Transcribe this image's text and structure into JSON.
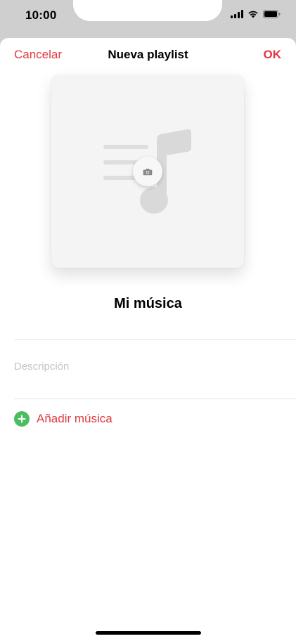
{
  "status_bar": {
    "time": "10:00"
  },
  "nav": {
    "cancel_label": "Cancelar",
    "title": "Nueva playlist",
    "ok_label": "OK"
  },
  "playlist": {
    "name": "Mi música",
    "description_placeholder": "Descripción",
    "description_value": ""
  },
  "actions": {
    "add_music_label": "Añadir música"
  },
  "icons": {
    "artwork": "music-note-icon",
    "camera": "camera-icon",
    "add": "plus-circle-icon",
    "signal": "cellular-signal-icon",
    "wifi": "wifi-icon",
    "battery": "battery-icon"
  },
  "colors": {
    "accent": "#e0393f",
    "add_icon": "#4cbd60",
    "placeholder": "#c4c4c4",
    "artwork_bg": "#f4f4f4"
  }
}
